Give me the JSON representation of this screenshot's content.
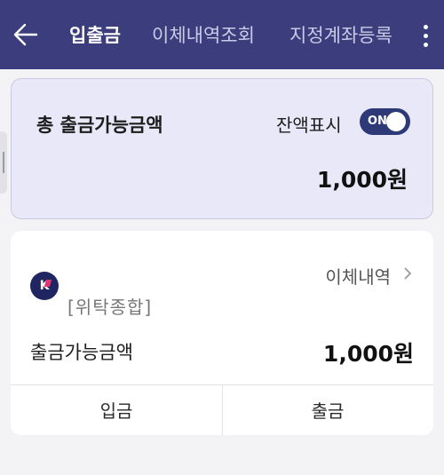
{
  "header": {
    "back_icon": "arrow-left-icon",
    "tabs": [
      {
        "label": "입출금",
        "active": true
      },
      {
        "label": "이체내역조회",
        "active": false
      },
      {
        "label": "지정계좌등록",
        "active": false
      }
    ],
    "more_icon": "more-vertical-icon",
    "background": "#3b3d7c"
  },
  "balance_card": {
    "title": "총 출금가능금액",
    "toggle_label": "잔액표시",
    "toggle_state": "ON",
    "amount": "1,000원"
  },
  "account": {
    "logo_letter": "K",
    "type": "[위탁종합]",
    "history_label": "이체내역",
    "available_label": "출금가능금액",
    "available_amount": "1,000원",
    "deposit_label": "입금",
    "withdraw_label": "출금"
  }
}
